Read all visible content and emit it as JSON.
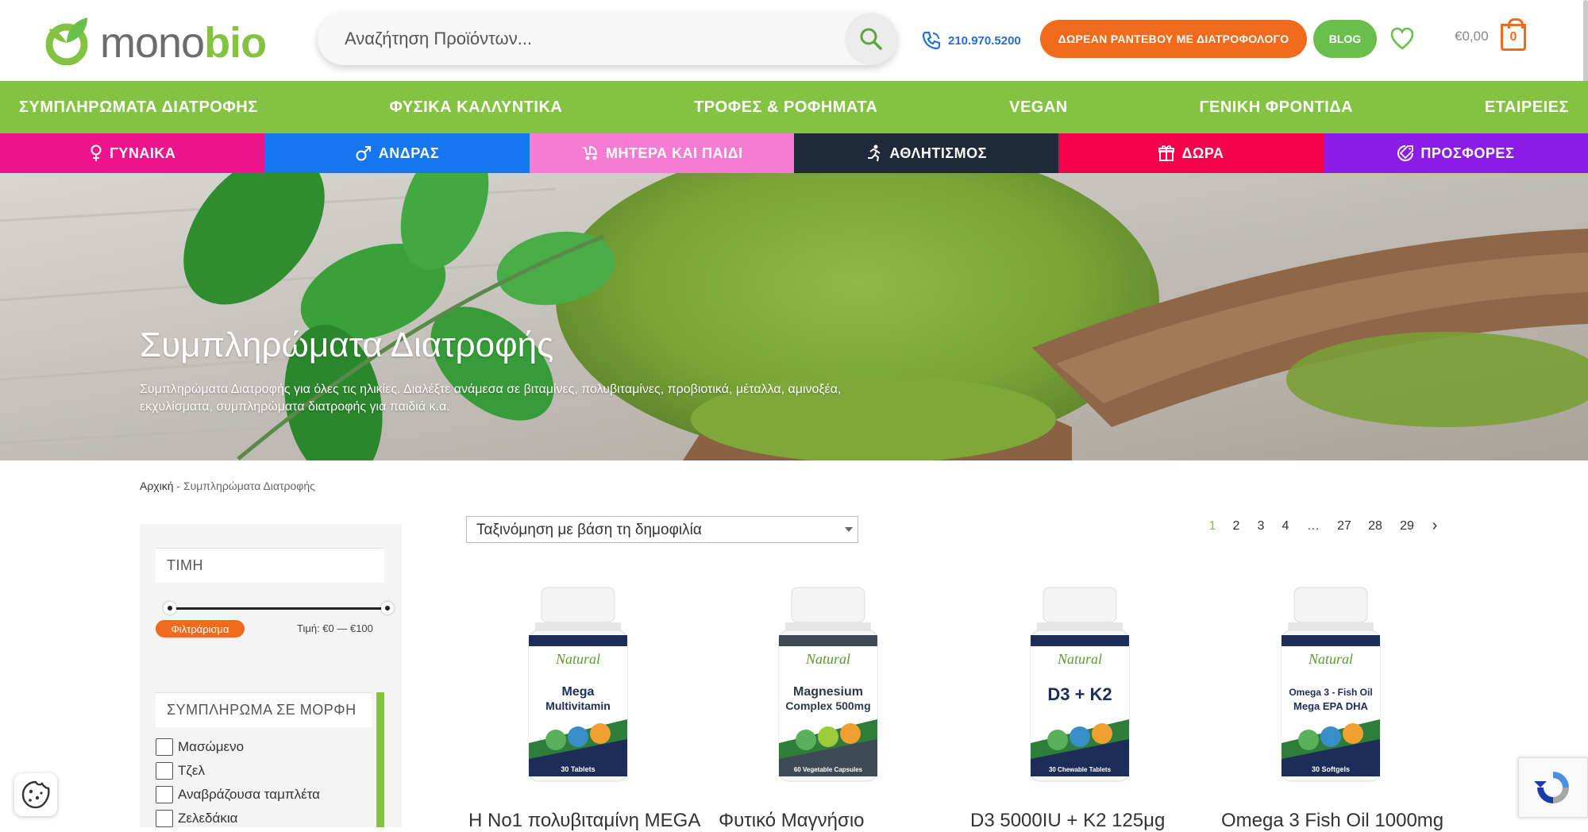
{
  "header": {
    "logo_mono": "mono",
    "logo_bio": "bio",
    "search_placeholder": "Αναζήτηση Προϊόντων...",
    "phone": "210.970.5200",
    "cta_label": "ΔΩΡΕΑΝ ΡΑΝΤΕΒΟΥ ΜΕ ΔΙΑΤΡΟΦΟΛΟΓΟ",
    "blog_label": "BLOG",
    "cart_total": "€0,00",
    "cart_count": "0"
  },
  "main_nav": [
    "ΣΥΜΠΛΗΡΩΜΑΤΑ ΔΙΑΤΡΟΦΗΣ",
    "ΦΥΣΙΚΑ ΚΑΛΛΥΝΤΙΚΑ",
    "ΤΡΟΦΕΣ & ΡΟΦΗΜΑΤΑ",
    "VEGAN",
    "ΓΕΝΙΚΗ ΦΡΟΝΤΙΔΑ",
    "ΕΤΑΙΡΕΙΕΣ"
  ],
  "category_nav": [
    {
      "label": "ΓΥΝΑΙΚΑ",
      "icon": "female-icon",
      "color": "#f0148c"
    },
    {
      "label": "ΑΝΔΡΑΣ",
      "icon": "male-icon",
      "color": "#1576ef"
    },
    {
      "label": "ΜΗΤΕΡΑ ΚΑΙ ΠΑΙΔΙ",
      "icon": "stroller-icon",
      "color": "#f77bd0"
    },
    {
      "label": "ΑΘΛΗΤΙΣΜΟΣ",
      "icon": "runner-icon",
      "color": "#1e2a3a"
    },
    {
      "label": "ΔΩΡΑ",
      "icon": "gift-icon",
      "color": "#f5004a"
    },
    {
      "label": "ΠΡΟΣΦΟΡΕΣ",
      "icon": "offer-tag-icon",
      "color": "#8c1de6"
    }
  ],
  "hero": {
    "title": "Συμπληρώματα Διατροφής",
    "description": "Συμπληρώματα Διατροφής για όλες τις ηλικίες. Διαλέξτε ανάμεσα σε βιταμίνες, πολυβιταμίνες, προβιοτικά, μέταλλα, αμινοξέα, εκχυλίσματα, συμπληρώματα διατροφής για παιδιά κ.α."
  },
  "breadcrumb": {
    "home": "Αρχική",
    "separator": " - ",
    "current": "Συμπληρώματα Διατροφής"
  },
  "sidebar": {
    "price_title": "ΤΙΜΗ",
    "filter_button": "Φιλτράρισμα",
    "price_range": "Τιμή: €0 — €100",
    "form_title": "ΣΥΜΠΛΗΡΩΜΑ ΣΕ ΜΟΡΦΗ",
    "options": [
      "Μασώμενο",
      "Τζελ",
      "Αναβράζουσα ταμπλέτα",
      "Ζελεδάκια"
    ]
  },
  "sort": {
    "label": "Ταξινόμηση με βάση τη δημοφιλία"
  },
  "pagination": {
    "pages": [
      "1",
      "2",
      "3",
      "4",
      "…",
      "27",
      "28",
      "29"
    ],
    "active": "1",
    "next": "›"
  },
  "products": [
    {
      "name": "Η Νο1 πολυβιταμίνη MEGA",
      "bottle_lines": [
        "Mega",
        "Multivitamin"
      ],
      "bottle_sub": "30 Tablets",
      "brand": "Natural"
    },
    {
      "name": "Φυτικό Μαγνήσιο",
      "bottle_lines": [
        "Magnesium",
        "Complex 500mg"
      ],
      "bottle_sub": "60 Vegetable Capsules",
      "brand": "Natural"
    },
    {
      "name": "D3 5000IU + K2 125μg",
      "bottle_lines": [
        "D3 + K2",
        ""
      ],
      "bottle_sub": "30 Chewable Tablets",
      "brand": "Natural"
    },
    {
      "name": "Omega 3 Fish Oil 1000mg",
      "bottle_lines": [
        "Omega 3 - Fish Oil",
        "Mega EPA DHA"
      ],
      "bottle_sub": "30 Softgels",
      "brand": "Natural"
    }
  ],
  "colors": {
    "brand_green": "#84c341",
    "accent_orange": "#f26a1b",
    "phone_blue": "#1f6fd6"
  }
}
